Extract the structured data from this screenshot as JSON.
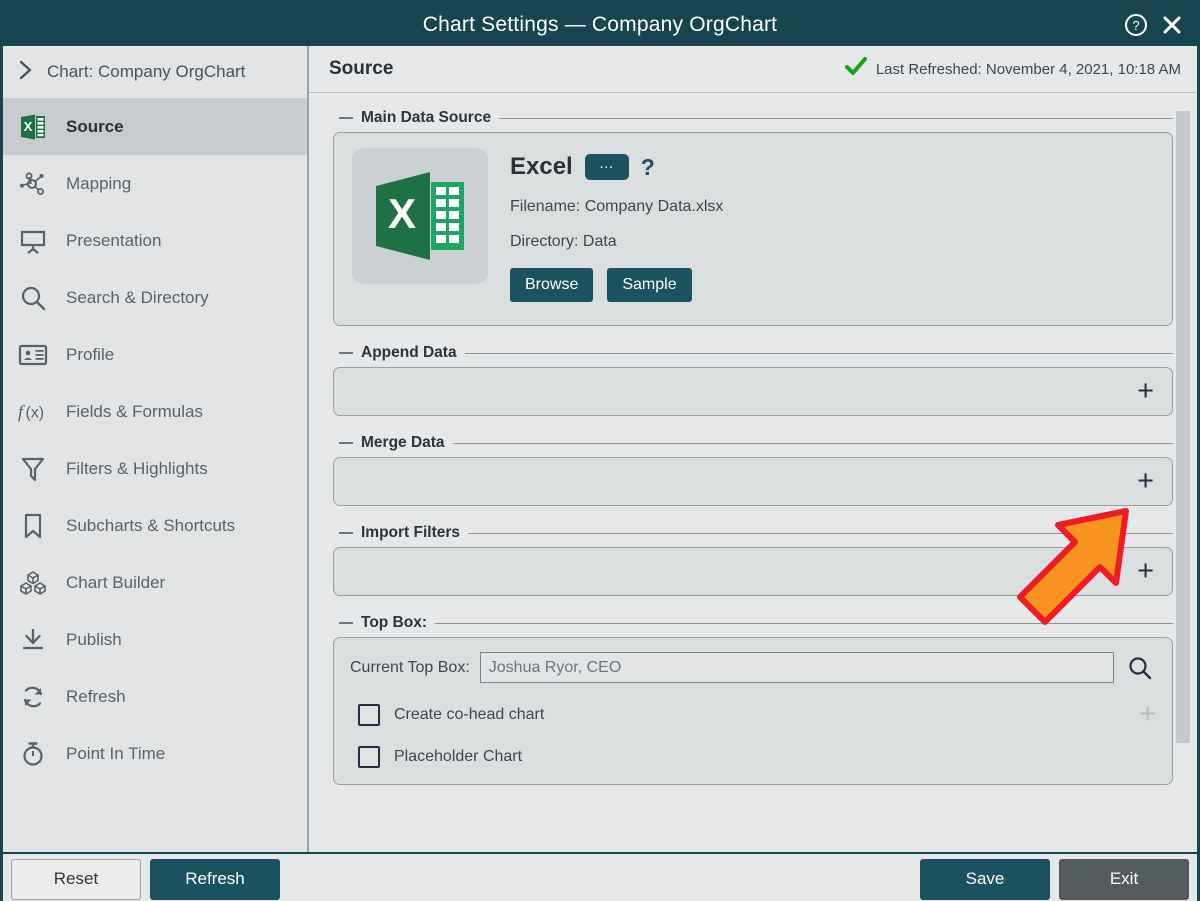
{
  "window": {
    "title": "Chart Settings — Company OrgChart",
    "help_icon": "question-circle-icon",
    "close_icon": "close-x-icon"
  },
  "sidebar": {
    "breadcrumb": {
      "icon": "chevron-right-icon",
      "label": "Chart: Company OrgChart"
    },
    "items": [
      {
        "label": "Source",
        "icon": "excel-file-icon",
        "active": true
      },
      {
        "label": "Mapping",
        "icon": "node-graph-icon",
        "active": false
      },
      {
        "label": "Presentation",
        "icon": "projector-screen-icon",
        "active": false
      },
      {
        "label": "Search & Directory",
        "icon": "magnifier-icon",
        "active": false
      },
      {
        "label": "Profile",
        "icon": "id-card-icon",
        "active": false
      },
      {
        "label": "Fields & Formulas",
        "icon": "function-fx-icon",
        "active": false
      },
      {
        "label": "Filters & Highlights",
        "icon": "funnel-icon",
        "active": false
      },
      {
        "label": "Subcharts & Shortcuts",
        "icon": "bookmark-icon",
        "active": false
      },
      {
        "label": "Chart Builder",
        "icon": "cubes-icon",
        "active": false
      },
      {
        "label": "Publish",
        "icon": "download-tray-icon",
        "active": false
      },
      {
        "label": "Refresh",
        "icon": "refresh-cycle-icon",
        "active": false
      },
      {
        "label": "Point In Time",
        "icon": "stopwatch-icon",
        "active": false
      }
    ]
  },
  "content": {
    "title": "Source",
    "refresh_status": {
      "icon": "green-check-icon",
      "text": "Last Refreshed: November 4, 2021, 10:18 AM"
    },
    "main_data_source": {
      "group_title": "Main Data Source",
      "logo_icon": "excel-logo-icon",
      "type": "Excel",
      "ellipsis_label": "…",
      "help_label": "?",
      "filename_line": "Filename: Company Data.xlsx",
      "directory_line": "Directory: Data",
      "browse_label": "Browse",
      "sample_label": "Sample"
    },
    "append_data": {
      "group_title": "Append Data",
      "add_icon": "plus-icon"
    },
    "merge_data": {
      "group_title": "Merge Data",
      "add_icon": "plus-icon"
    },
    "import_filters": {
      "group_title": "Import Filters",
      "add_icon": "plus-icon"
    },
    "top_box": {
      "group_title": "Top Box:",
      "field_label": "Current Top Box:",
      "field_value": "Joshua Ryor, CEO",
      "field_placeholder": "Joshua Ryor, CEO",
      "search_icon": "magnifier-icon",
      "checkboxes": [
        {
          "label": "Create co-head chart",
          "checked": false
        },
        {
          "label": "Placeholder Chart",
          "checked": false
        }
      ],
      "add_icon": "plus-icon"
    }
  },
  "footer": {
    "reset_label": "Reset",
    "refresh_label": "Refresh",
    "save_label": "Save",
    "exit_label": "Exit"
  },
  "annotation": {
    "type": "arrow",
    "points_at": "merge-data-add-button",
    "fill_color": "#F7941E",
    "stroke_color": "#EE1C25"
  },
  "colors": {
    "titlebar": "#16454f",
    "accent_teal": "#1b5260",
    "excel_green": "#1e7145",
    "status_green": "#13a513",
    "panel_bg": "#dcdfe0",
    "app_bg": "#e6e8e9"
  }
}
